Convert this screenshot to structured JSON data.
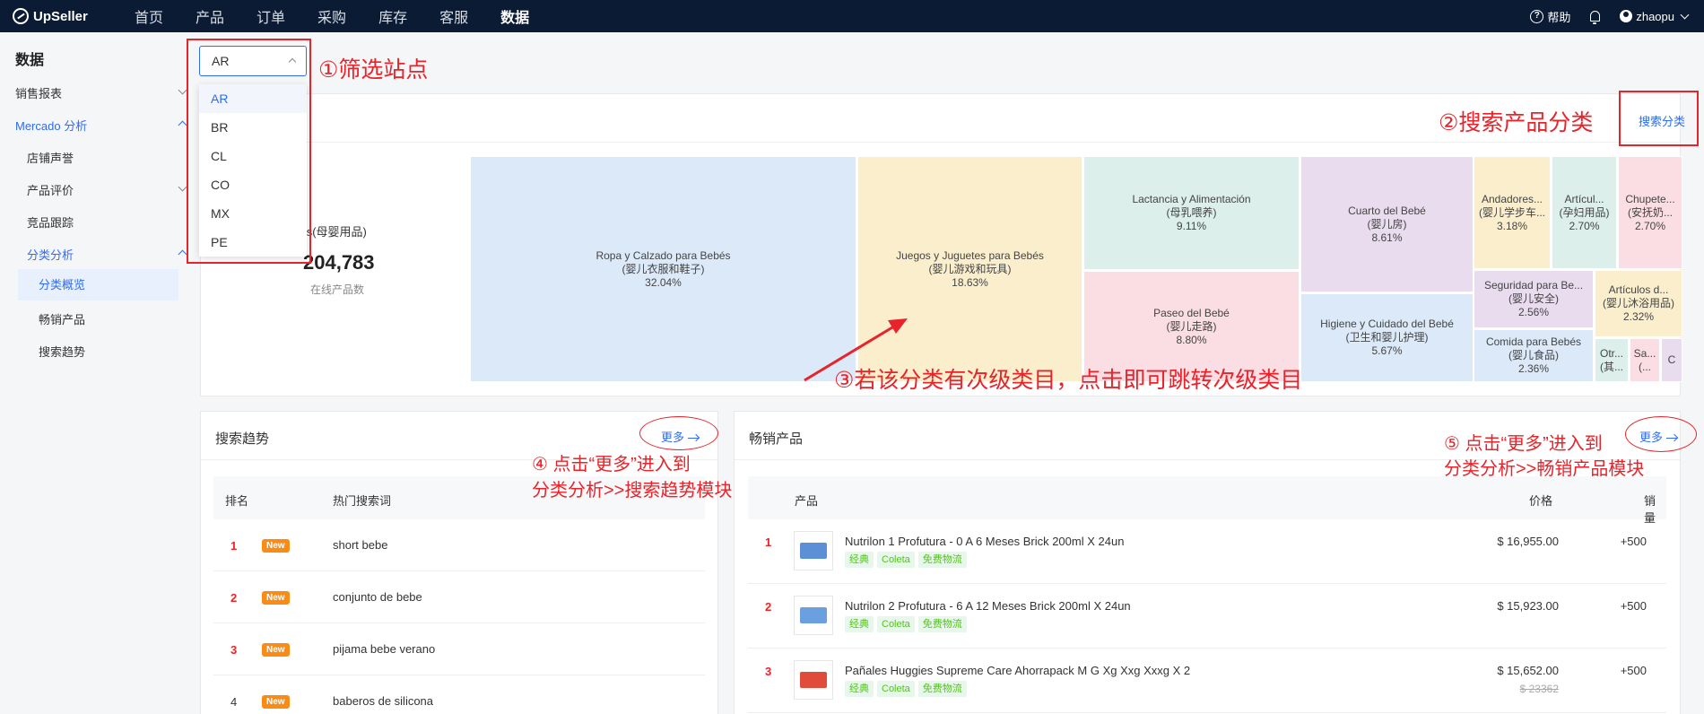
{
  "nav": {
    "logo": "UpSeller",
    "items": [
      "首页",
      "产品",
      "订单",
      "采购",
      "库存",
      "客服",
      "数据"
    ],
    "help": "帮助",
    "user": "zhaopu"
  },
  "sidebar": {
    "title": "数据",
    "sales_report": "销售报表",
    "mercado": "Mercado 分析",
    "shop_reputation": "店铺声誉",
    "product_review": "产品评价",
    "competitor": "竞品跟踪",
    "category_analysis": "分类分析",
    "category_overview": "分类概览",
    "best_selling": "畅销产品",
    "search_trend": "搜索趋势"
  },
  "site_select": {
    "value": "AR",
    "options": [
      "AR",
      "BR",
      "CL",
      "CO",
      "MX",
      "PE"
    ]
  },
  "category_panel": {
    "search_link": "搜索分类",
    "stat_category": "ebés(母婴用品)",
    "stat_value": "204,783",
    "stat_label": "在线产品数"
  },
  "treemap": [
    {
      "name": "Ropa y Calzado para Bebés",
      "cn": "(婴儿衣服和鞋子)",
      "pct": "32.04%",
      "color": "#dbe9f8"
    },
    {
      "name": "Juegos y Juguetes para Bebés",
      "cn": "(婴儿游戏和玩具)",
      "pct": "18.63%",
      "color": "#faeecd"
    },
    {
      "name": "Lactancia y Alimentación",
      "cn": "(母乳喂养)",
      "pct": "9.11%",
      "color": "#dcefea"
    },
    {
      "name": "Paseo del Bebé",
      "cn": "(婴儿走路)",
      "pct": "8.80%",
      "color": "#fbdde4"
    },
    {
      "name": "Cuarto del Bebé",
      "cn": "(婴儿房)",
      "pct": "8.61%",
      "color": "#e9dcef"
    },
    {
      "name": "Higiene y Cuidado del Bebé",
      "cn": "(卫生和婴儿护理)",
      "pct": "5.67%",
      "color": "#dbe9f8"
    },
    {
      "name": "Andadores...",
      "cn": "(婴儿学步车...",
      "pct": "3.18%",
      "color": "#faeecd"
    },
    {
      "name": "Artícul...",
      "cn": "(孕妇用品)",
      "pct": "2.70%",
      "color": "#dcefea"
    },
    {
      "name": "Chupete...",
      "cn": "(安抚奶...",
      "pct": "2.70%",
      "color": "#fbdde4"
    },
    {
      "name": "Seguridad para Be...",
      "cn": "(婴儿安全)",
      "pct": "2.56%",
      "color": "#e9dcef"
    },
    {
      "name": "Artículos d...",
      "cn": "(婴儿沐浴用品)",
      "pct": "2.32%",
      "color": "#faeecd"
    },
    {
      "name": "Comida para Bebés",
      "cn": "(婴儿食品)",
      "pct": "2.36%",
      "color": "#dbe9f8"
    },
    {
      "name": "Otr...",
      "cn": "(其...",
      "pct": "",
      "color": "#dcefea"
    },
    {
      "name": "Sa...",
      "cn": "(...",
      "pct": "",
      "color": "#fbdde4"
    },
    {
      "name": "C",
      "cn": "",
      "pct": "",
      "color": "#e9dcef"
    }
  ],
  "search_trend": {
    "title": "搜索趋势",
    "more": "更多",
    "col_rank": "排名",
    "col_term": "热门搜索词",
    "badge": "New",
    "rows": [
      {
        "rank": "1",
        "term": "short bebe"
      },
      {
        "rank": "2",
        "term": "conjunto de bebe"
      },
      {
        "rank": "3",
        "term": "pijama bebe verano"
      },
      {
        "rank": "4",
        "term": "baberos de silicona"
      }
    ]
  },
  "best_selling": {
    "title": "畅销产品",
    "more": "更多",
    "col_product": "产品",
    "col_price": "价格",
    "col_sales": "销量",
    "rows": [
      {
        "rank": "1",
        "name": "Nutrilon 1 Profutura - 0 A 6 Meses Brick 200ml X 24un",
        "tags": [
          "经典",
          "Coleta",
          "免费物流"
        ],
        "price": "$ 16,955.00",
        "old_price": "",
        "sales": "+500"
      },
      {
        "rank": "2",
        "name": "Nutrilon 2 Profutura - 6 A 12 Meses Brick 200ml X 24un",
        "tags": [
          "经典",
          "Coleta",
          "免费物流"
        ],
        "price": "$ 15,923.00",
        "old_price": "",
        "sales": "+500"
      },
      {
        "rank": "3",
        "name": "Pañales Huggies Supreme Care Ahorrapack M G Xg Xxg Xxxg X 2",
        "tags": [
          "经典",
          "Coleta",
          "免费物流"
        ],
        "price": "$ 15,652.00",
        "old_price": "$ 23362",
        "sales": "+500"
      }
    ]
  },
  "annotations": {
    "a1": "①筛选站点",
    "a2": "②搜索产品分类",
    "a3": "③若该分类有次级类目，点击即可跳转次级类目",
    "a4_line1": "④ 点击“更多”进入到",
    "a4_line2": "分类分析>>搜索趋势模块",
    "a5_line1": "⑤ 点击“更多”进入到",
    "a5_line2": "分类分析>>畅销产品模块"
  }
}
